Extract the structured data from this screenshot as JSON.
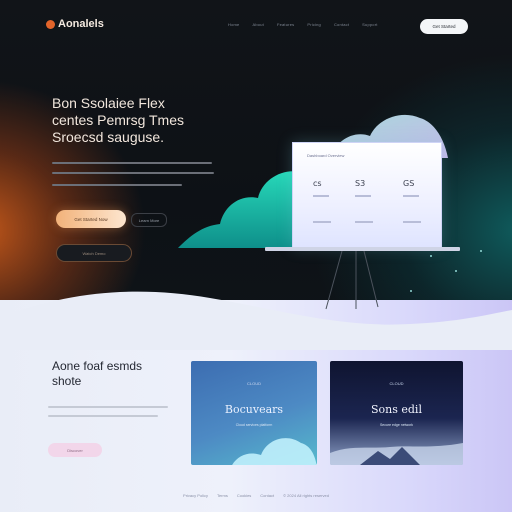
{
  "brand": {
    "name": "Aonalels",
    "accent": "#e2642a"
  },
  "nav": {
    "items": [
      "Home",
      "About",
      "Features",
      "Pricing",
      "Contact",
      "Support"
    ],
    "cta": "Get Started"
  },
  "hero": {
    "title_lines": [
      "Bon Ssolaiee Flex",
      "centes Pemrsg Tmes",
      "Sroecsd sauguse."
    ],
    "primary_button": "Get Started Now",
    "secondary_button": "Learn More",
    "tertiary_button": "Watch Demo"
  },
  "dashboard": {
    "title": "Dashboard Overview",
    "stats": [
      "cs",
      "S3",
      "GS"
    ]
  },
  "section": {
    "title_lines": [
      "Aone foaf esmds",
      "shote"
    ],
    "button": "Discover"
  },
  "cards": [
    {
      "kicker": "CLOUD",
      "title": "Bocuvears",
      "subtitle": "Cloud services platform"
    },
    {
      "kicker": "CLOUD",
      "title": "Sons edil",
      "subtitle": "Secure edge network"
    }
  ],
  "footer": {
    "items": [
      "Privacy Policy",
      "Terms",
      "Cookies",
      "Contact",
      "© 2024 All rights reserved"
    ]
  },
  "colors": {
    "hero_bg": "#0d1116",
    "teal": "#1fc9b0",
    "orange": "#c2571a",
    "lavender": "#cbc6f6"
  },
  "icons": {
    "logo": "flame-icon",
    "cloud": "cloud-icon",
    "mountain": "mountain-icon"
  }
}
